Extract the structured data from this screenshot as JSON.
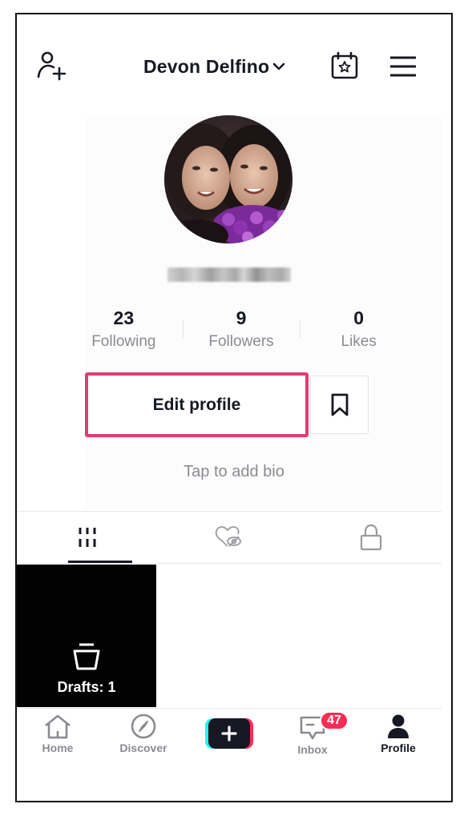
{
  "header": {
    "title": "Devon Delfino",
    "icons": {
      "add_user": "person-add-icon",
      "title_dropdown": "chevron-down-icon",
      "calendar": "calendar-star-icon",
      "menu": "hamburger-menu-icon"
    }
  },
  "profile": {
    "avatar_alt": "Profile photo",
    "username_blurred": true,
    "stats": [
      {
        "value": "23",
        "label": "Following"
      },
      {
        "value": "9",
        "label": "Followers"
      },
      {
        "value": "0",
        "label": "Likes"
      }
    ],
    "edit_button": "Edit profile",
    "bookmark_icon": "bookmark-icon",
    "bio_placeholder": "Tap to add bio",
    "highlight_color": "#e43b73"
  },
  "tabs": [
    {
      "name": "videos",
      "icon": "grid-icon",
      "active": true
    },
    {
      "name": "liked",
      "icon": "heart-hidden-icon",
      "active": false
    },
    {
      "name": "private",
      "icon": "lock-icon",
      "active": false
    }
  ],
  "drafts": {
    "label": "Drafts: 1",
    "icon": "drafts-bin-icon"
  },
  "nav": {
    "items": [
      {
        "label": "Home",
        "icon": "home-icon",
        "active": false
      },
      {
        "label": "Discover",
        "icon": "compass-icon",
        "active": false
      },
      {
        "label": "",
        "icon": "plus-icon",
        "active": false
      },
      {
        "label": "Inbox",
        "icon": "message-icon",
        "active": false
      },
      {
        "label": "Profile",
        "icon": "person-icon",
        "active": true
      }
    ],
    "inbox_badge": "47",
    "colors": {
      "cyan": "#25f4ee",
      "red": "#fe2c55",
      "dark": "#161823"
    }
  }
}
